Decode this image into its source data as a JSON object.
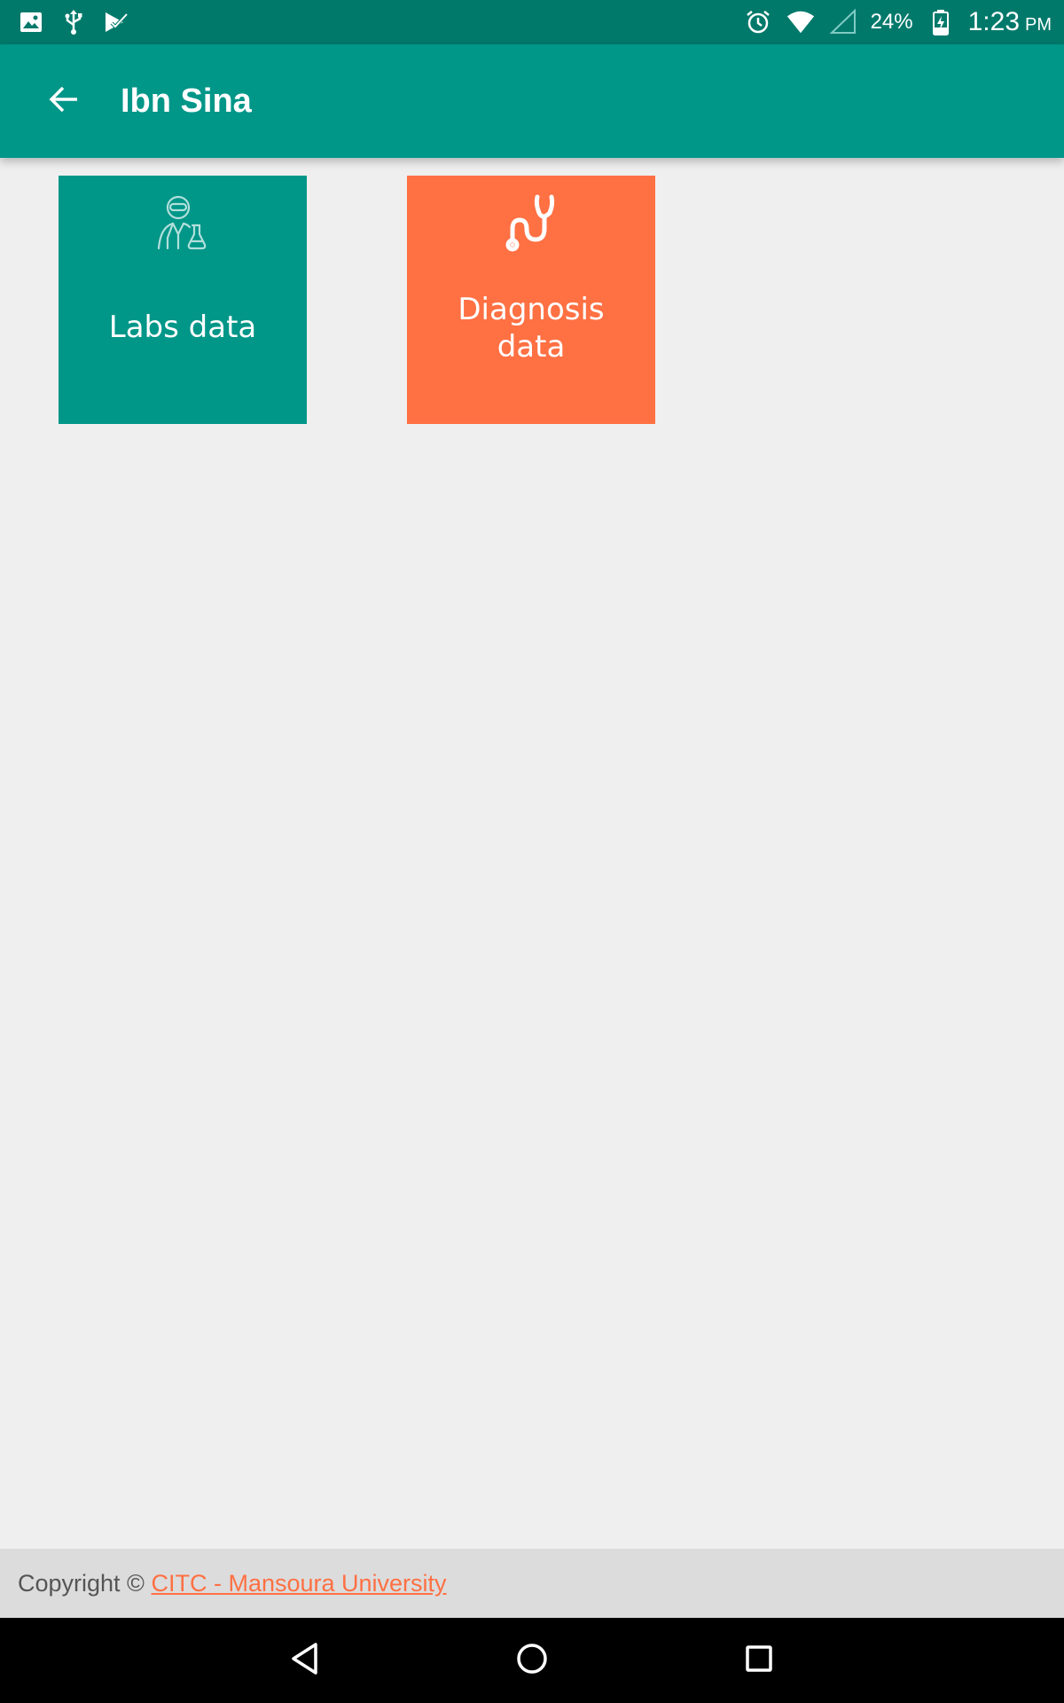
{
  "status_bar": {
    "icons_left": [
      "image-icon",
      "usb-icon",
      "play-store-icon"
    ],
    "icons_right": [
      "alarm-icon",
      "wifi-icon",
      "cell-signal-icon",
      "battery-charging-icon"
    ],
    "battery_percent": "24%",
    "time": "1:23",
    "ampm": "PM",
    "color": "#00796b"
  },
  "app_bar": {
    "title": "Ibn Sina",
    "back_icon": "arrow-back-icon",
    "color": "#009688"
  },
  "tiles": [
    {
      "label": "Labs data",
      "icon": "lab-scientist-icon",
      "color": "#009688"
    },
    {
      "label": "Diagnosis data",
      "icon": "stethoscope-icon",
      "color": "#ff7043"
    }
  ],
  "footer": {
    "prefix": "Copyright ©",
    "link_text": "CITC - Mansoura University",
    "link_color": "#ff7043"
  },
  "nav_bar": {
    "buttons": [
      "nav-back-icon",
      "nav-home-icon",
      "nav-recents-icon"
    ]
  }
}
